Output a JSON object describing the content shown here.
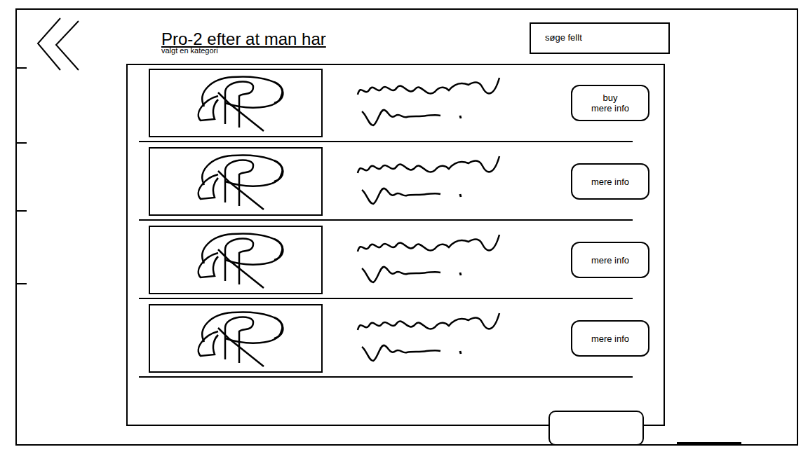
{
  "page": {
    "title": "Pro-2 efter at man har",
    "subtitle": "valgt en kategori"
  },
  "search": {
    "label": "søge fellt"
  },
  "items": [
    {
      "button_labels": [
        "buy",
        "mere info"
      ]
    },
    {
      "button_labels": [
        "mere info"
      ]
    },
    {
      "button_labels": [
        "mere info"
      ]
    },
    {
      "button_labels": [
        "mere info"
      ]
    }
  ],
  "footer_button": {
    "label": ""
  }
}
